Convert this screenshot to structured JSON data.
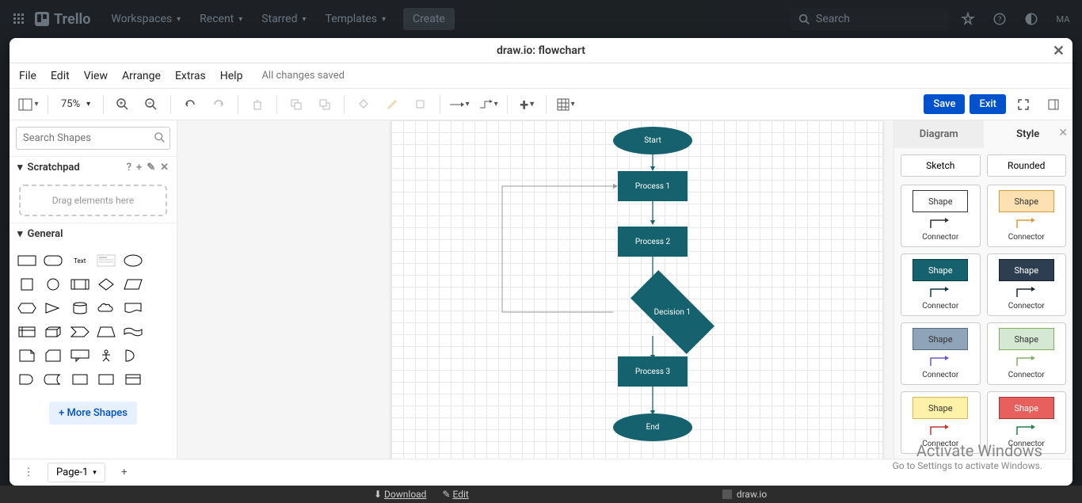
{
  "trello": {
    "brand": "Trello",
    "nav": [
      "Workspaces",
      "Recent",
      "Starred",
      "Templates"
    ],
    "create": "Create",
    "search_ph": "Search",
    "avatar": "MA"
  },
  "modal": {
    "title": "draw.io: flowchart",
    "menu": [
      "File",
      "Edit",
      "View",
      "Arrange",
      "Extras",
      "Help"
    ],
    "save_status": "All changes saved",
    "zoom": "75%",
    "save_btn": "Save",
    "exit_btn": "Exit"
  },
  "sidebar": {
    "search_ph": "Search Shapes",
    "scratchpad": "Scratchpad",
    "drop_hint": "Drag elements here",
    "general": "General",
    "more_shapes": "+ More Shapes"
  },
  "flowchart": {
    "start": "Start",
    "p1": "Process 1",
    "p2": "Process 2",
    "d1": "Decision 1",
    "p3": "Process 3",
    "end": "End"
  },
  "right": {
    "tab_diagram": "Diagram",
    "tab_style": "Style",
    "sketch": "Sketch",
    "rounded": "Rounded",
    "shape_label": "Shape",
    "connector_label": "Connector",
    "styles": [
      {
        "bg": "#ffffff",
        "fg": "#333333",
        "border": "#333333",
        "conn": "#333333"
      },
      {
        "bg": "#fde1b3",
        "fg": "#333333",
        "border": "#d99a3a",
        "conn": "#d99a3a"
      },
      {
        "bg": "#15616d",
        "fg": "#ffffff",
        "border": "#0d3b44",
        "conn": "#0d3b44"
      },
      {
        "bg": "#2c3e50",
        "fg": "#ffffff",
        "border": "#1a252f",
        "conn": "#1a252f"
      },
      {
        "bg": "#8fa4b8",
        "fg": "#333333",
        "border": "#5a6e82",
        "conn": "#6a5acd"
      },
      {
        "bg": "#d4e8d4",
        "fg": "#333333",
        "border": "#82b366",
        "conn": "#82b366"
      },
      {
        "bg": "#fff2a8",
        "fg": "#333333",
        "border": "#d6b656",
        "conn": "#c0392b"
      },
      {
        "bg": "#e8605d",
        "fg": "#ffffff",
        "border": "#a8322f",
        "conn": "#1e8449"
      }
    ]
  },
  "page_tabs": {
    "page1": "Page-1"
  },
  "bottom": {
    "download": "Download",
    "edit": "Edit",
    "drawio": "draw.io"
  },
  "watermark": {
    "l1": "Activate Windows",
    "l2": "Go to Settings to activate Windows."
  }
}
